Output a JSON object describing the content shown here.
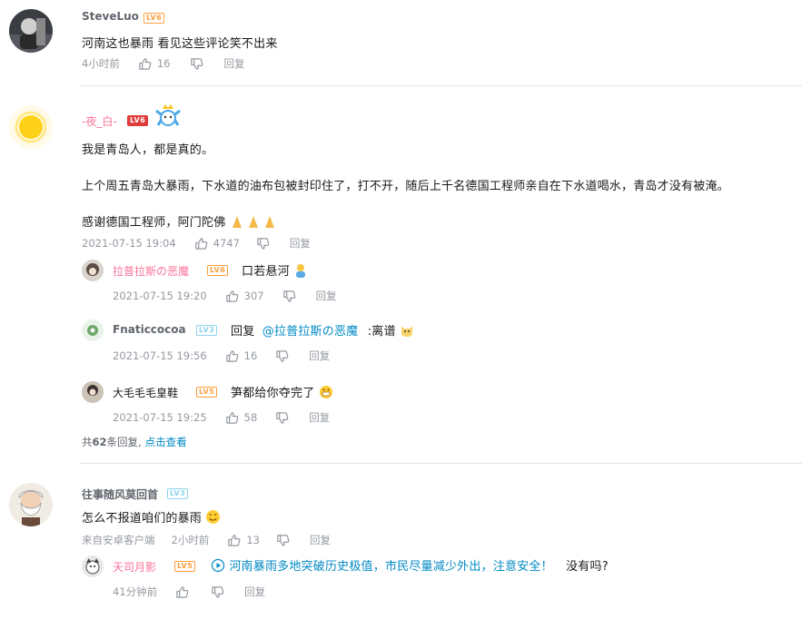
{
  "comments": [
    {
      "user": "SteveLuo",
      "level": "LV6",
      "text": "河南这也暴雨 看见这些评论笑不出来",
      "time": "4小时前",
      "likes": "16",
      "reply_label": "回复",
      "avatar_icon": "avatar-photo-icon"
    },
    {
      "user": "-夜_白-",
      "level": "LV6",
      "lines": [
        "我是青岛人，都是真的。",
        "上个周五青岛大暴雨，下水道的油布包被封印住了，打不开，随后上千名德国工程师亲自在下水道喝水，青岛才没有被淹。",
        "感谢德国工程师，阿门陀佛"
      ],
      "time": "2021-07-15 19:04",
      "likes": "4747",
      "reply_label": "回复",
      "replies": [
        {
          "user": "拉普拉斯の恶魔",
          "level": "LV6",
          "text": "口若悬河",
          "time": "2021-07-15 19:20",
          "likes": "307",
          "reply_label": "回复"
        },
        {
          "user": "Fnaticcocoa",
          "level": "LV3",
          "reply_prefix": "回复",
          "mention": "@拉普拉斯の恶魔",
          "text": ":离谱",
          "time": "2021-07-15 19:56",
          "likes": "16",
          "reply_label": "回复"
        },
        {
          "user": "大毛毛毛皇鞋",
          "level": "LV5",
          "text": "笋都给你夺完了",
          "time": "2021-07-15 19:25",
          "likes": "58",
          "reply_label": "回复"
        }
      ],
      "total_replies_prefix": "共",
      "total_replies_count": "62",
      "total_replies_suffix": "条回复,",
      "view_more": "点击查看"
    },
    {
      "user": "往事随风莫回首",
      "level": "LV3",
      "text": "怎么不报道咱们的暴雨",
      "source": "来自安卓客户端",
      "time": "2小时前",
      "likes": "13",
      "reply_label": "回复",
      "replies": [
        {
          "user": "天司月影",
          "level": "LV5",
          "link_text": "河南暴雨多地突破历史极值，市民尽量减少外出，注意安全！",
          "text": "没有吗?",
          "time": "41分钟前",
          "reply_label": "回复"
        }
      ]
    }
  ],
  "colors": {
    "pink": "#fb7299",
    "link": "#008ac5",
    "meta": "#9499a0",
    "level_orange": "#ff9f3d",
    "level_red": "#e23b3b",
    "level_blue": "#8fd3ef"
  }
}
